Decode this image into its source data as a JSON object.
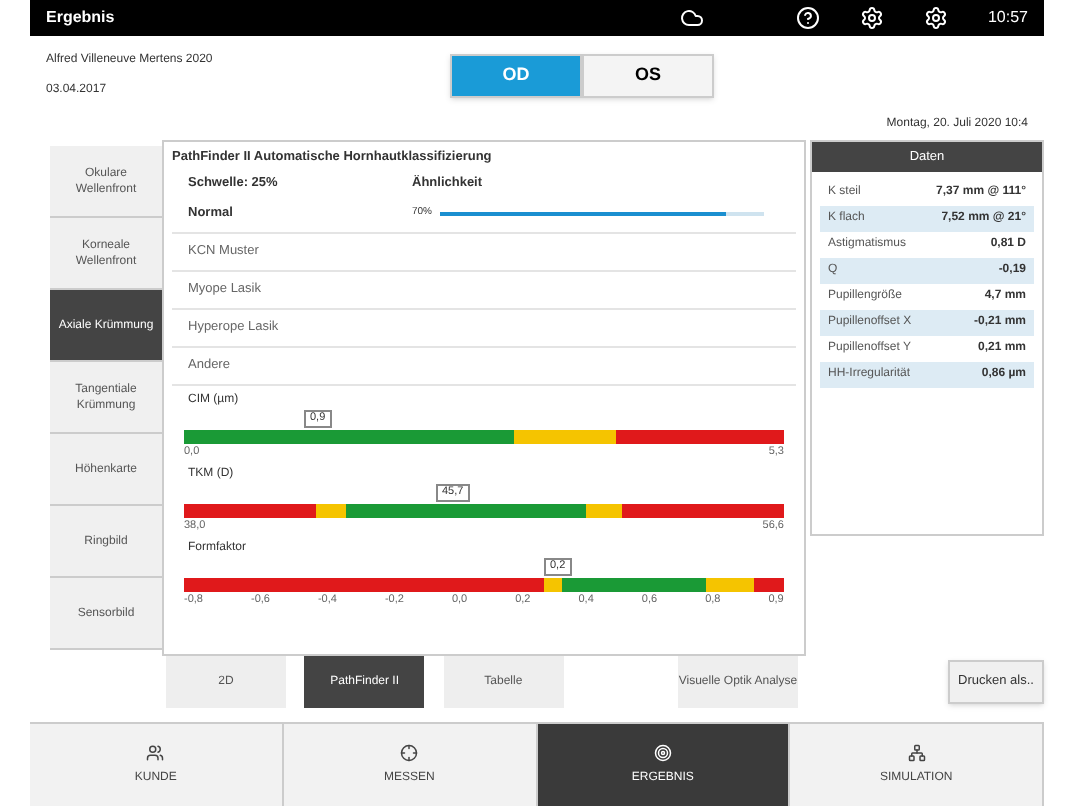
{
  "header": {
    "title": "Ergebnis",
    "time": "10:57"
  },
  "patient": {
    "name": "Alfred Villeneuve Mertens 2020",
    "birth_date": "03.04.2017",
    "date": "Montag, 20. Juli 2020 10:4"
  },
  "eye_tabs": [
    {
      "label": "OD",
      "selected": true
    },
    {
      "label": "OS",
      "selected": false
    }
  ],
  "sidebar": [
    {
      "label": "Okulare Wellenfront",
      "selected": false
    },
    {
      "label": "Korneale Wellenfront",
      "selected": false
    },
    {
      "label": "Axiale Krümmung",
      "selected": true
    },
    {
      "label": "Tangentiale Krümmung",
      "selected": false
    },
    {
      "label": "Höhenkarte",
      "selected": false
    },
    {
      "label": "Ringbild",
      "selected": false
    },
    {
      "label": "Sensorbild",
      "selected": false
    }
  ],
  "pathfinder": {
    "title": "PathFinder II Automatische Hornhautklassifizierung",
    "threshold": "Schwelle: 25%",
    "similarity_header": "Ähnlichkeit",
    "classes": [
      {
        "label": "Normal",
        "similarity": "70%",
        "level": 0.88
      },
      {
        "label": "KCN Muster"
      },
      {
        "label": "Myope Lasik"
      },
      {
        "label": "Hyperope Lasik"
      },
      {
        "label": "Andere"
      }
    ],
    "scales": [
      {
        "label": "CIM (µm)",
        "marker": "0,9",
        "ticks": [
          "0,0",
          "5,3"
        ],
        "segments": [
          {
            "color": "#1a9a36"
          },
          {
            "color": "#f5c400"
          },
          {
            "color": "#e0191b"
          }
        ]
      },
      {
        "label": "TKM (D)",
        "marker": "45,7",
        "ticks": [
          "38,0",
          "56,6"
        ],
        "segments": [
          {
            "color": "#e0191b"
          },
          {
            "color": "#f5c400"
          },
          {
            "color": "#1a9a36"
          },
          {
            "color": "#f5c400"
          },
          {
            "color": "#e0191b"
          }
        ]
      },
      {
        "label": "Formfaktor",
        "marker": "0,2",
        "ticks": [
          "-0,8",
          "-0,6",
          "-0,4",
          "-0,2",
          "0,0",
          "0,2",
          "0,4",
          "0,6",
          "0,8",
          "0,9"
        ],
        "segments": [
          {
            "color": "#e0191b"
          },
          {
            "color": "#f5c400"
          },
          {
            "color": "#1a9a36"
          },
          {
            "color": "#f5c400"
          },
          {
            "color": "#e0191b"
          }
        ]
      }
    ]
  },
  "view_tabs": [
    {
      "label": "2D",
      "selected": false
    },
    {
      "label": "PathFinder II",
      "selected": true
    },
    {
      "label": "Tabelle",
      "selected": false
    },
    {
      "label": "Visuelle Optik Analyse",
      "selected": false
    }
  ],
  "data_panel": {
    "title": "Daten",
    "rows": [
      {
        "label": "K steil",
        "value": "7,37 mm @ 111°"
      },
      {
        "label": "K flach",
        "value": "7,52 mm @ 21°"
      },
      {
        "label": "Astigmatismus",
        "value": "0,81 D"
      },
      {
        "label": "Q",
        "value": "-0,19"
      },
      {
        "label": "Pupillengröße",
        "value": "4,7 mm"
      },
      {
        "label": "Pupillenoffset X",
        "value": "-0,21 mm"
      },
      {
        "label": "Pupillenoffset Y",
        "value": "0,21 mm"
      },
      {
        "label": "HH-Irregularität",
        "value": "0,86 µm"
      }
    ]
  },
  "print_button": "Drucken als..",
  "nav": [
    {
      "label": "KUNDE",
      "selected": false
    },
    {
      "label": "MESSEN",
      "selected": false
    },
    {
      "label": "ERGEBNIS",
      "selected": true
    },
    {
      "label": "SIMULATION",
      "selected": false
    }
  ]
}
